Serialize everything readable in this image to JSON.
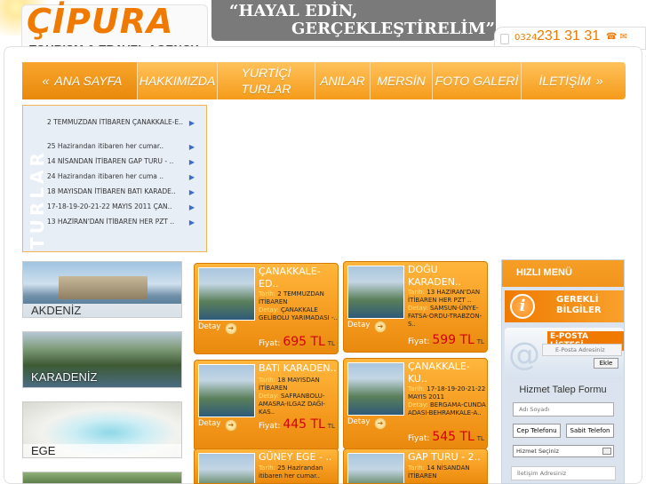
{
  "header": {
    "logo_text": "ÇİPURA",
    "logo_sub": "TOURISM & TRAVEL AGENCY",
    "slogan_1": "“HAYAL EDİN,",
    "slogan_2": "GERÇEKLEŞTİRELİM”",
    "phone_prefix": "0324",
    "phone_number": "231 31 31",
    "phone_icons": "☎ ✉"
  },
  "nav": {
    "left_arrow": "«",
    "right_arrow": "»",
    "items": [
      {
        "label": "ANA SAYFA"
      },
      {
        "label": "HAKKIMIZDA"
      },
      {
        "label": "YURTİÇİ TURLAR"
      },
      {
        "label": "ANILAR"
      },
      {
        "label": "MERSİN"
      },
      {
        "label": "FOTO GALERİ"
      },
      {
        "label": "İLETİŞİM"
      }
    ]
  },
  "tours": {
    "vertical_label": "TURLAR",
    "items": [
      {
        "text": "2 TEMMUZDAN İTİBAREN ÇANAKKALE-E.."
      },
      {
        "text": "25 Hazirandan itibaren her cumar.."
      },
      {
        "text": "14 NİSANDAN İTİBAREN GAP TURU - .."
      },
      {
        "text": "24 Hazirandan itibaren her cuma .."
      },
      {
        "text": "18 MAYISDAN İTİBAREN BATI KARADE.."
      },
      {
        "text": "17-18-19-20-21-22 MAYIS 2011 ÇAN.."
      },
      {
        "text": "13 HAZİRAN'DAN İTİBAREN HER PZT .."
      }
    ]
  },
  "regions": [
    {
      "label": "AKDENİZ"
    },
    {
      "label": "KARADENİZ"
    },
    {
      "label": "EGE"
    }
  ],
  "cards": [
    {
      "title": "ÇANAKKALE-ED..",
      "tarih_label": "Tarih:",
      "tarih": "2 TEMMUZDAN İTİBAREN",
      "detay_label": "Detay:",
      "detay": "ÇANAKKALE GELİBOLU YARIMADASI -..",
      "detay_btn": "Detay",
      "fiyat_label": "Fiyat:",
      "price": "695 TL",
      "currency": "TL"
    },
    {
      "title": "DOĞU KARADEN..",
      "tarih_label": "Tarih:",
      "tarih": "13 HAZİRAN'DAN İTİBAREN HER PZT ..",
      "detay_label": "Detay:",
      "detay": "SAMSUN-ÜNYE-FATSA-ORDU-TRABZON-S..",
      "detay_btn": "Detay",
      "fiyat_label": "Fiyat:",
      "price": "599 TL",
      "currency": "TL"
    },
    {
      "title": "BATI KARADEN..",
      "tarih_label": "Tarih:",
      "tarih": "18 MAYISDAN İTİBAREN",
      "detay_label": "Detay:",
      "detay": "SAFRANBOLU-AMASRA-ILGAZ DAĞI-KAS..",
      "detay_btn": "Detay",
      "fiyat_label": "Fiyat:",
      "price": "445 TL",
      "currency": "TL"
    },
    {
      "title": "ÇANAKKALE-KU..",
      "tarih_label": "Tarih:",
      "tarih": "17-18-19-20-21-22 MAYIS 2011",
      "detay_label": "Detay:",
      "detay": "BERGAMA-CUNDA ADASI-BEHRAMKALE-A..",
      "detay_btn": "Detay",
      "fiyat_label": "Fiyat:",
      "price": "545 TL",
      "currency": "TL"
    },
    {
      "title": "GÜNEY EGE - ..",
      "tarih_label": "Tarih:",
      "tarih": "25 Hazirandan itibaren her cumar..",
      "detay_label": "",
      "detay": "",
      "detay_btn": "",
      "fiyat_label": "",
      "price": "",
      "currency": ""
    },
    {
      "title": "GAP TURU - 2..",
      "tarih_label": "Tarih:",
      "tarih": "14 NİSANDAN İTİBAREN",
      "detay_label": "",
      "detay": "",
      "detay_btn": "",
      "fiyat_label": "",
      "price": "",
      "currency": ""
    }
  ],
  "quick_menu": {
    "title": "HIZLI MENÜ",
    "info_icon": "i",
    "info_text_1": "GEREKLİ",
    "info_text_2": "BİLGİLER",
    "mail_at": "@",
    "mail_title": "E-POSTA LİSTESİ",
    "mail_placeholder": "E-Posta Adresiniz",
    "mail_button": "Ekle",
    "form_title": "Hizmet Talep Formu",
    "name_placeholder": "Adı Soyadı",
    "mobile_button": "Cep Telefonu",
    "landline_button": "Sabit Telefon",
    "service_select": "Hizmet Seçiniz",
    "address_placeholder": "İletişim Adresiniz"
  }
}
